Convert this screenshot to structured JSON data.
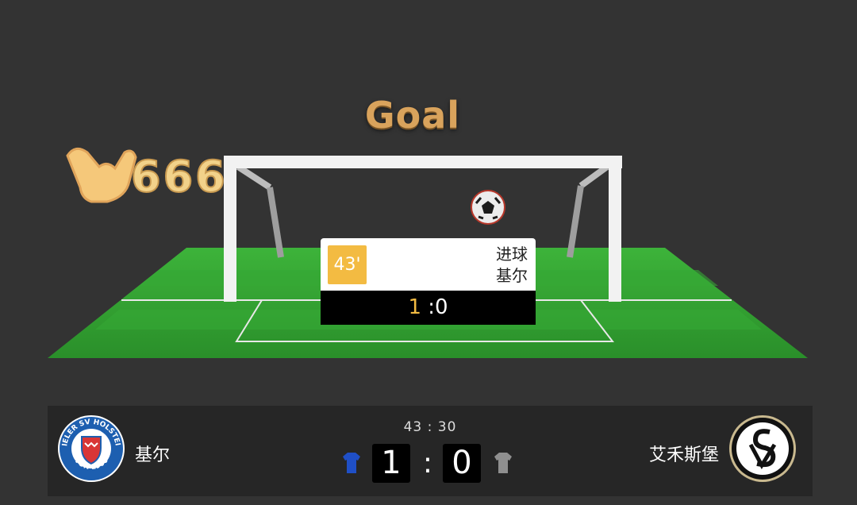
{
  "animation": {
    "title": "Goal",
    "brand_text": "666"
  },
  "event": {
    "minute": "43'",
    "type": "进球",
    "team": "基尔",
    "score_home": "1",
    "score_separator": " :",
    "score_away": "0"
  },
  "scoreboard": {
    "clock": "43 : 30",
    "home": {
      "name": "基尔",
      "score": "1",
      "kit_color": "#1f4fc6",
      "badge_text_top": "KIELER SV HOLSTEIN",
      "badge_text_bottom": "VON 1900"
    },
    "away": {
      "name": "艾禾斯堡",
      "score": "0",
      "kit_color": "#8f8f8f"
    },
    "separator": ":"
  },
  "colors": {
    "accent": "#f3bb42",
    "pitch": "#3aa83a",
    "background": "#333333"
  }
}
